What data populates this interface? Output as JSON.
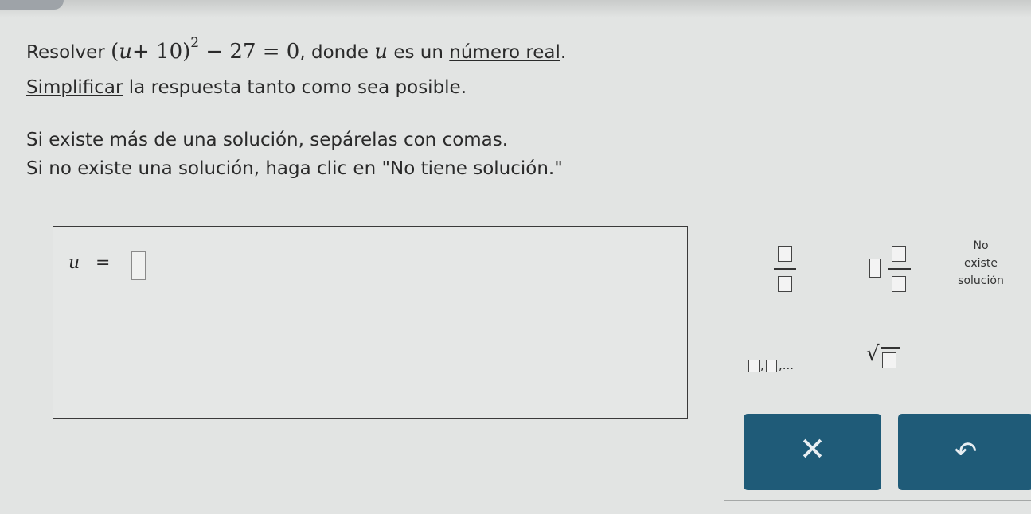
{
  "prompt": {
    "line1_prefix": "Resolver",
    "eq_open": "(",
    "eq_var": "u",
    "eq_plus10": "+ 10)",
    "eq_exp": "2",
    "eq_rest": "− 27 = 0",
    "line1_middle": ", donde",
    "line1_var": "u",
    "line1_suffix": "es un",
    "line1_link": "número real",
    "line1_end": ".",
    "line2_link": "Simplificar",
    "line2_rest": "la respuesta tanto como sea posible.",
    "line3": "Si existe más de una solución, sepárelas con comas.",
    "line4": "Si no existe una solución, haga clic en \"No tiene solución.\""
  },
  "answer": {
    "var": "u",
    "eq": "=",
    "value": ""
  },
  "keypad": {
    "no_solution": [
      "No",
      "existe",
      "solución"
    ],
    "list_comma": ",",
    "list_ellipsis": ",..."
  },
  "actions": {
    "clear": "✕",
    "undo": "↶"
  },
  "colors": {
    "background": "#e2e4e3",
    "button": "#1f5b78"
  }
}
